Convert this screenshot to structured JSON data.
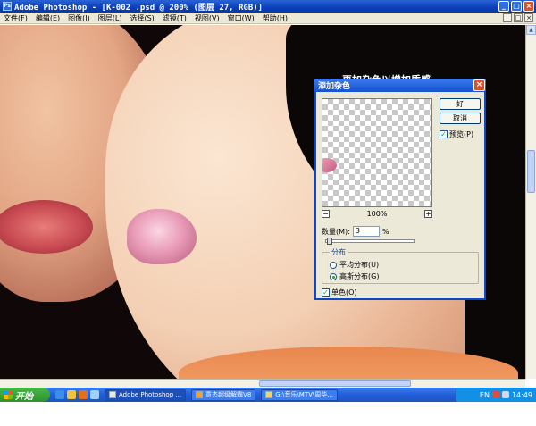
{
  "window": {
    "title": "Adobe Photoshop - [K-002 .psd @ 200% (图层 27, RGB)]",
    "app_icon": "Ps",
    "buttons": {
      "minimize": "_",
      "maximize": "□",
      "close": "×"
    }
  },
  "menubar": {
    "items": [
      "文件(F)",
      "编辑(E)",
      "图像(I)",
      "图层(L)",
      "选择(S)",
      "滤镜(T)",
      "视图(V)",
      "窗口(W)",
      "帮助(H)"
    ],
    "doc_buttons": [
      "_",
      "□",
      "×"
    ]
  },
  "canvas": {
    "annotation": "再加杂色以增加质感。"
  },
  "dialog": {
    "title": "添加杂色",
    "ok_label": "好",
    "cancel_label": "取消",
    "preview_label": "预览(P)",
    "preview_checked": true,
    "zoom_minus": "−",
    "zoom_plus": "+",
    "zoom_level": "100%",
    "amount_label": "数量(M):",
    "amount_value": "3",
    "amount_unit": "%",
    "amount_percent": 3,
    "distribution_label": "分布",
    "distribution_options": [
      "平均分布(U)",
      "高斯分布(G)"
    ],
    "distribution_selected": 1,
    "monochrome_label": "单色(O)",
    "monochrome_checked": true
  },
  "taskbar": {
    "start_label": "开始",
    "tasks": [
      "Adobe Photoshop ...",
      "意杰超级解霸V8",
      "G:\\音乐\\MTV\\周华..."
    ],
    "active_task": 0,
    "tray_lang": "EN",
    "clock": "14:49"
  },
  "colors": {
    "titlebar": "#0a3fb8",
    "dialog_bg": "#ece9d8",
    "taskbar": "#235ed8",
    "start_button": "#2d922d"
  }
}
